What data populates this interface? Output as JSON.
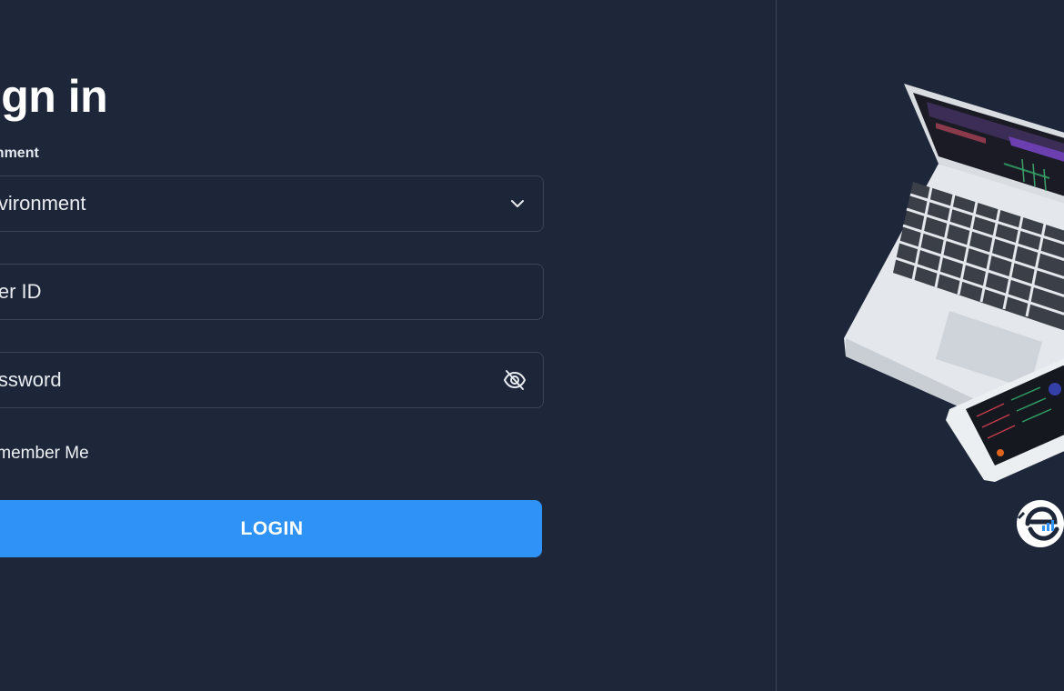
{
  "login_form": {
    "title": "Sign in",
    "environment": {
      "label": "Environment",
      "value": "Environment"
    },
    "user_id": {
      "placeholder": "User ID"
    },
    "password": {
      "placeholder": "Password"
    },
    "remember_me": {
      "label": "Remember Me",
      "checked": false
    },
    "login_button": "LOGIN"
  },
  "icons": {
    "environment_dropdown": "chevron-down-icon",
    "password_toggle": "eye-off-icon",
    "brand": "logo-icon"
  },
  "colors": {
    "background": "#1e2739",
    "field_border": "#3a4457",
    "primary_button": "#2f92f7",
    "text": "#e8ebf0"
  }
}
